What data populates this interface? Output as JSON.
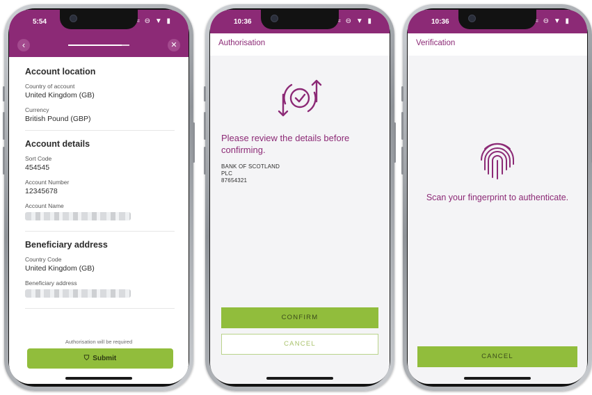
{
  "phones": [
    {
      "status": {
        "time": "5:54",
        "icons": "≈ ⊖ ▼ ▮"
      },
      "nav": {
        "back_icon": "chevron-left-icon",
        "close_icon": "close-icon",
        "progress": 0.88
      },
      "sections": {
        "location": {
          "title": "Account location",
          "country_label": "Country of account",
          "country_value": "United Kingdom (GB)",
          "currency_label": "Currency",
          "currency_value": "British Pound (GBP)"
        },
        "details": {
          "title": "Account details",
          "sort_label": "Sort Code",
          "sort_value": "454545",
          "number_label": "Account Number",
          "number_value": "12345678",
          "name_label": "Account Name"
        },
        "beneficiary": {
          "title": "Beneficiary address",
          "country_label": "Country Code",
          "country_value": "United Kingdom (GB)",
          "address_label": "Beneficiary address"
        }
      },
      "auth_note": "Authorisation will be required",
      "submit_label": "Submit"
    },
    {
      "status": {
        "time": "10:36",
        "icons": "≈ ⊖ ▼ ▮"
      },
      "title": "Authorisation",
      "review_text": "Please review the details before confirming.",
      "bank_lines": [
        "BANK OF SCOTLAND",
        "PLC",
        "87654321"
      ],
      "confirm_label": "CONFIRM",
      "cancel_label": "CANCEL"
    },
    {
      "status": {
        "time": "10:36",
        "icons": "≈ ⊖ ▼ ▮"
      },
      "title": "Verification",
      "scan_text": "Scan your fingerprint to authenticate.",
      "cancel_label": "CANCEL"
    }
  ],
  "colors": {
    "brand_purple": "#8c2a76",
    "accent_green": "#91bd3c"
  }
}
